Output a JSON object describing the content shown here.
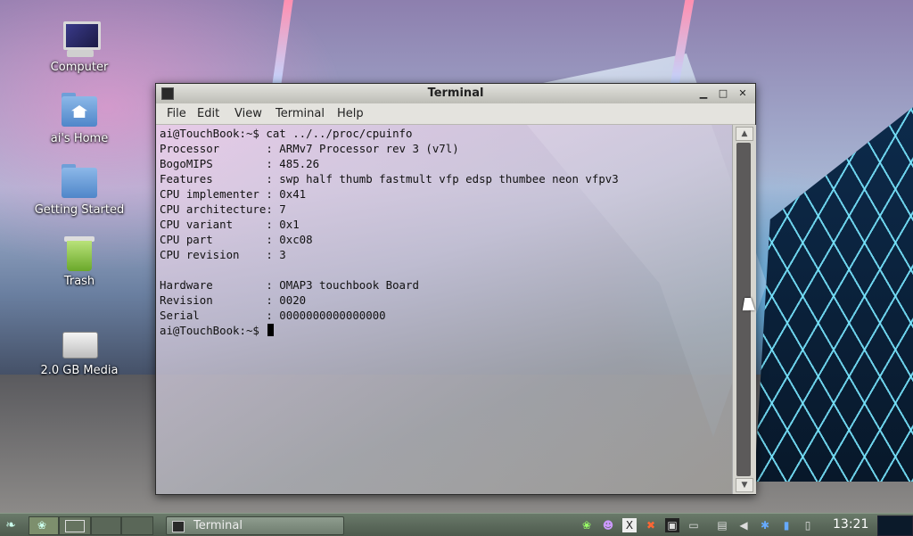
{
  "desktop": {
    "icons": [
      {
        "label": "Computer"
      },
      {
        "label": "ai's Home"
      },
      {
        "label": "Getting Started"
      },
      {
        "label": "Trash"
      },
      {
        "label": "2.0 GB Media"
      }
    ]
  },
  "window": {
    "title": "Terminal",
    "menu": [
      "File",
      "Edit",
      "View",
      "Terminal",
      "Help"
    ],
    "lines": [
      "ai@TouchBook:~$ cat ../../proc/cpuinfo",
      "Processor       : ARMv7 Processor rev 3 (v7l)",
      "BogoMIPS        : 485.26",
      "Features        : swp half thumb fastmult vfp edsp thumbee neon vfpv3",
      "CPU implementer : 0x41",
      "CPU architecture: 7",
      "CPU variant     : 0x1",
      "CPU part        : 0xc08",
      "CPU revision    : 3",
      "",
      "Hardware        : OMAP3 touchbook Board",
      "Revision        : 0020",
      "Serial          : 0000000000000000"
    ],
    "prompt": "ai@TouchBook:~$ "
  },
  "taskbar": {
    "task_label": "Terminal",
    "clock": "13:21"
  },
  "icons": {
    "start": "foot-icon",
    "minimize": "minimize-icon",
    "maximize": "maximize-icon",
    "close": "close-icon"
  }
}
